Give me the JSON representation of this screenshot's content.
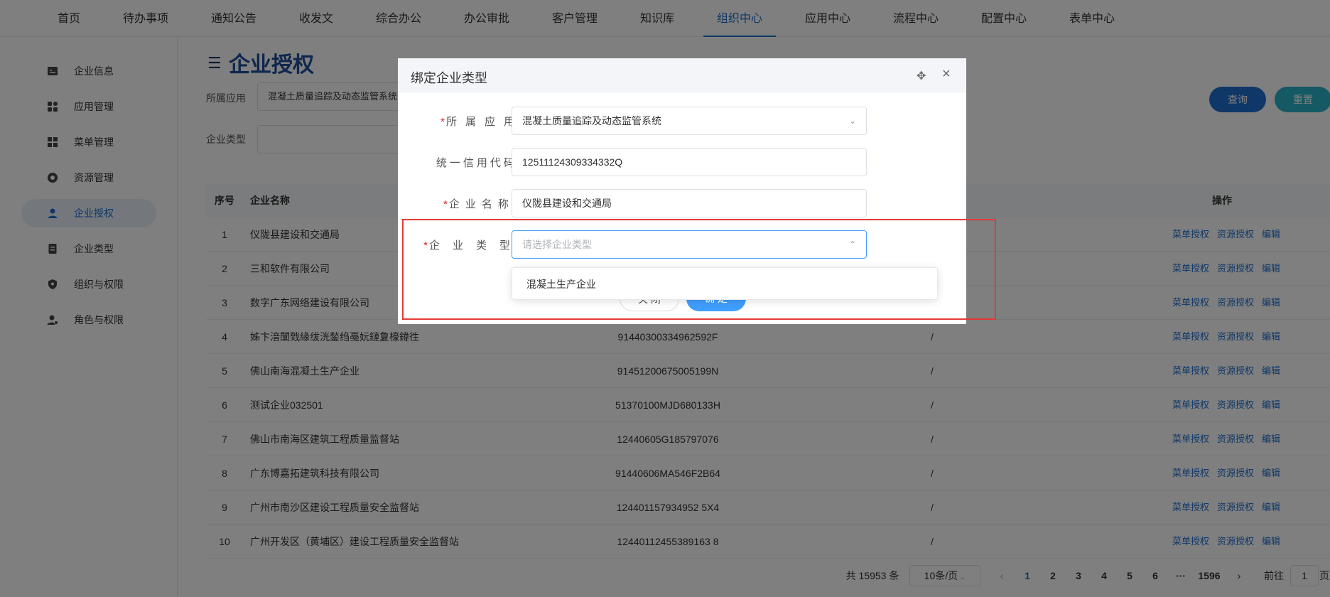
{
  "topnav": {
    "items": [
      "首页",
      "待办事项",
      "通知公告",
      "收发文",
      "综合办公",
      "办公审批",
      "客户管理",
      "知识库",
      "组织中心",
      "应用中心",
      "流程中心",
      "配置中心",
      "表单中心"
    ],
    "active_index": 8
  },
  "sidebar": {
    "items": [
      {
        "label": "企业信息",
        "icon": "enterprise-info-icon"
      },
      {
        "label": "应用管理",
        "icon": "app-grid-icon"
      },
      {
        "label": "菜单管理",
        "icon": "menu-grid-icon"
      },
      {
        "label": "资源管理",
        "icon": "resource-icon"
      },
      {
        "label": "企业授权",
        "icon": "user-auth-icon"
      },
      {
        "label": "企业类型",
        "icon": "document-icon"
      },
      {
        "label": "组织与权限",
        "icon": "shield-icon"
      },
      {
        "label": "角色与权限",
        "icon": "role-user-icon"
      }
    ],
    "active_index": 4
  },
  "main": {
    "title": "企业授权",
    "filters": {
      "app_label": "所属应用",
      "app_value": "混凝土质量追踪及动态监管系统",
      "type_label": "企业类型",
      "type_value": ""
    },
    "buttons": {
      "query": "查询",
      "reset": "重置"
    },
    "table": {
      "headers": {
        "index": "序号",
        "name": "企业名称",
        "ops": "操作"
      },
      "rows": [
        {
          "index": "1",
          "name": "仪陇县建设和交通局",
          "code": "",
          "type": ""
        },
        {
          "index": "2",
          "name": "三和软件有限公司",
          "code": "",
          "type": ""
        },
        {
          "index": "3",
          "name": "数字广东网络建设有限公司",
          "code": "",
          "type": ""
        },
        {
          "index": "4",
          "name": "姊卞湆闃戣緣绂洸鍫绉戞妧鏈夐檺鍏徃",
          "code": "91440300334962592F",
          "type": "/"
        },
        {
          "index": "5",
          "name": "佛山南海混凝土生产企业",
          "code": "91451200675005199N",
          "type": "/"
        },
        {
          "index": "6",
          "name": "测试企业032501",
          "code": "51370100MJD680133H",
          "type": "/"
        },
        {
          "index": "7",
          "name": "佛山市南海区建筑工程质量监督站",
          "code": "12440605G185797076",
          "type": "/"
        },
        {
          "index": "8",
          "name": "广东博嘉拓建筑科技有限公司",
          "code": "91440606MA546F2B64",
          "type": "/"
        },
        {
          "index": "9",
          "name": "广州市南沙区建设工程质量安全监督站",
          "code": "124401157934952 5X4",
          "type": "/"
        },
        {
          "index": "10",
          "name": "广州开发区（黄埔区）建设工程质量安全监督站",
          "code": "12440112455389163 8",
          "type": "/"
        }
      ],
      "op_labels": [
        "菜单授权",
        "资源授权",
        "编辑"
      ]
    },
    "pagination": {
      "total": "共 15953 条",
      "page_size": "10条/页",
      "pages": [
        "1",
        "2",
        "3",
        "4",
        "5",
        "6",
        "···",
        "1596"
      ],
      "current": "1",
      "goto_label": "前往",
      "goto_value": "1",
      "goto_suffix": "页"
    }
  },
  "dialog": {
    "title": "绑定企业类型",
    "fields": [
      {
        "label": "所属应用",
        "required": true,
        "value": "混凝土质量追踪及动态监管系统",
        "kind": "select"
      },
      {
        "label": "统一信用代码:",
        "required": false,
        "value": "12511124309334332Q",
        "kind": "text"
      },
      {
        "label": "企业名称:",
        "required": true,
        "value": "仪陇县建设和交通局",
        "kind": "text"
      },
      {
        "label": "企业类型",
        "required": true,
        "placeholder": "请选择企业类型",
        "kind": "select-open"
      }
    ],
    "buttons": {
      "cancel": "关 闭",
      "confirm": "确 定"
    },
    "dropdown_options": [
      "混凝土生产企业"
    ]
  },
  "colors": {
    "accent": "#1f6fd0",
    "brand_title": "#1f4e9c",
    "highlight": "#e53935",
    "query_btn": "#1f6fd0",
    "reset_btn": "#2bb3c8"
  }
}
